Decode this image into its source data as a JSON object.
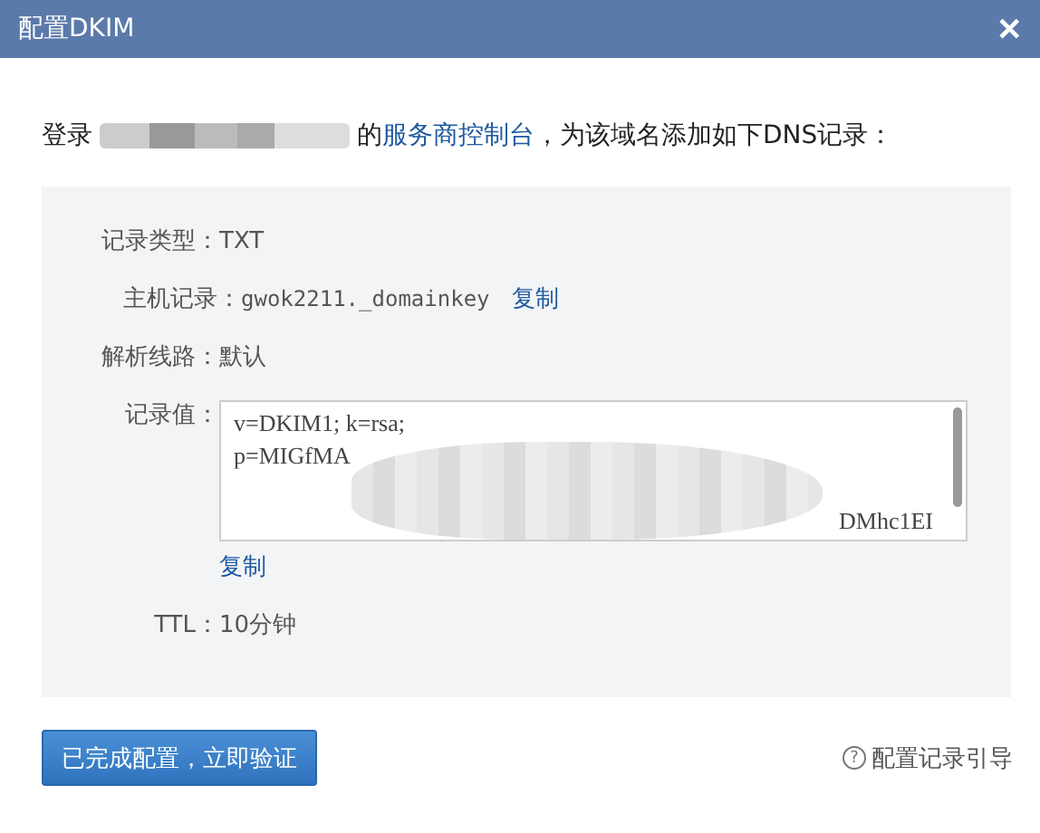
{
  "dialog": {
    "title": "配置DKIM",
    "close": "✕"
  },
  "instruction": {
    "before": "登录",
    "after_domain": "的",
    "link": "服务商控制台",
    "rest": "，为该域名添加如下DNS记录："
  },
  "record": {
    "fields": [
      {
        "kind": "text",
        "label": "记录类型：",
        "value": "TXT"
      },
      {
        "kind": "copy",
        "label": "主机记录：",
        "value": "gwok2211._domainkey",
        "action": "复制"
      },
      {
        "kind": "text",
        "label": "解析线路：",
        "value": "默认"
      },
      {
        "kind": "textarea",
        "label": "记录值：",
        "lines": [
          {
            "left": "v=DKIM1; k=rsa;"
          },
          {
            "left": "p=MIGfMA"
          }
        ],
        "last_line_end": "DMhc1EI",
        "action": "复制"
      },
      {
        "kind": "text",
        "label": "TTL：",
        "value": "10分钟"
      }
    ]
  },
  "confirm_button": "已完成配置，立即验证",
  "help_link": {
    "icon": "?",
    "label": "配置记录引导"
  }
}
